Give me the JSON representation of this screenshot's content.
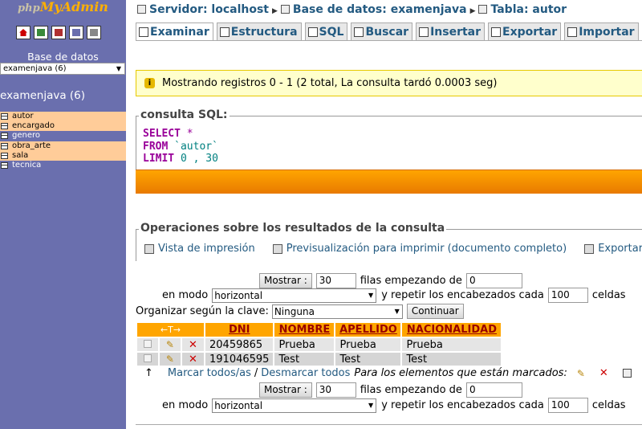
{
  "nav": {
    "logo_prefix": "php",
    "logo_main": "MyAdmin",
    "icons": [
      "home-icon",
      "query-window-icon",
      "sql-icon",
      "docs-icon",
      "reload-icon"
    ],
    "db_label": "Base de datos",
    "db_select": "examenjava (6)",
    "db_title": "examenjava (6)",
    "tables": [
      {
        "name": "autor",
        "highlight": true
      },
      {
        "name": "encargado",
        "highlight": true
      },
      {
        "name": "genero",
        "highlight": false
      },
      {
        "name": "obra_arte",
        "highlight": true
      },
      {
        "name": "sala",
        "highlight": true
      },
      {
        "name": "tecnica",
        "highlight": false
      }
    ]
  },
  "breadcrumb": {
    "server": "Servidor: localhost",
    "database": "Base de datos: examenjava",
    "table": "Tabla: autor"
  },
  "tabs": [
    "Examinar",
    "Estructura",
    "SQL",
    "Buscar",
    "Insertar",
    "Exportar",
    "Importar"
  ],
  "notice": "Mostrando registros 0 - 1 (2 total, La consulta tardó 0.0003 seg)",
  "sql": {
    "legend": "consulta SQL:",
    "line1_kw": "SELECT",
    "line1_rest": "*",
    "line2_kw": "FROM",
    "line2_rest": "`autor`",
    "line3_kw": "LIMIT",
    "line3_a": "0",
    "line3_sep": ",",
    "line3_b": "30"
  },
  "operations": {
    "legend": "Operaciones sobre los resultados de la consulta",
    "print_view": "Vista de impresión",
    "print_preview": "Previsualización para imprimir (documento completo)",
    "export": "Exportar"
  },
  "navigation": {
    "show_button": "Mostrar :",
    "rows": "30",
    "start_label": "filas empezando de",
    "start": "0",
    "mode_label": "en modo",
    "mode": "horizontal",
    "repeat_label": "y repetir los encabezados cada",
    "repeat": "100",
    "cells_label": "celdas"
  },
  "sort": {
    "label": "Organizar según la clave:",
    "value": "Ninguna",
    "button": "Continuar"
  },
  "table": {
    "arrows": "←T→",
    "columns": [
      "DNI",
      "NOMBRE",
      "APELLIDO",
      "NACIONALIDAD"
    ],
    "rows": [
      [
        "20459865",
        "Prueba",
        "Prueba",
        "Prueba"
      ],
      [
        "191046595",
        "Test",
        "Test",
        "Test"
      ]
    ]
  },
  "mark": {
    "arrow": "↑",
    "check_all": "Marcar todos/as",
    "separator": "/",
    "uncheck_all": "Desmarcar todos",
    "with_selected": "Para los elementos que están marcados:"
  },
  "colors": {
    "sidebar": "#6a6fae",
    "header_orange": "#ffa500",
    "link_blue": "#235a81",
    "notice_bg": "#ffffcc"
  }
}
